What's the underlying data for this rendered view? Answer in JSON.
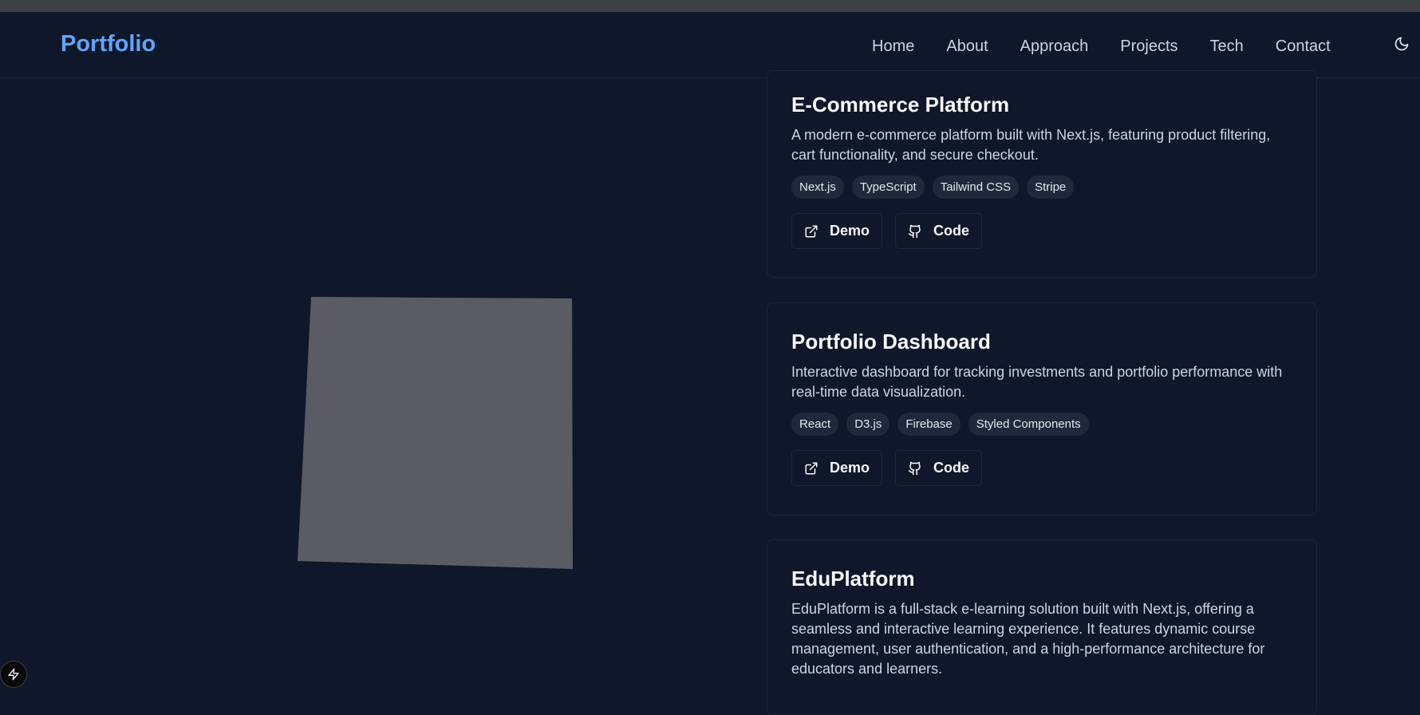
{
  "brand": "Portfolio",
  "nav": [
    "Home",
    "About",
    "Approach",
    "Projects",
    "Tech",
    "Contact"
  ],
  "icons": {
    "theme": "moon-icon",
    "demo": "external-link-icon",
    "code": "github-icon",
    "badge": "lightning-icon"
  },
  "colors": {
    "background": "#0f172a",
    "brand": "#60a5fa",
    "placeholder": "#5b5b63"
  },
  "projects": [
    {
      "title": "E-Commerce Platform",
      "description": "A modern e-commerce platform built with Next.js, featuring product filtering, cart functionality, and secure checkout.",
      "tags": [
        "Next.js",
        "TypeScript",
        "Tailwind CSS",
        "Stripe"
      ],
      "demo_label": "Demo",
      "code_label": "Code"
    },
    {
      "title": "Portfolio Dashboard",
      "description": "Interactive dashboard for tracking investments and portfolio performance with real-time data visualization.",
      "tags": [
        "React",
        "D3.js",
        "Firebase",
        "Styled Components"
      ],
      "demo_label": "Demo",
      "code_label": "Code"
    },
    {
      "title": "EduPlatform",
      "description": "EduPlatform is a full-stack e-learning solution built with Next.js, offering a seamless and interactive learning experience. It features dynamic course management, user authentication, and a high-performance architecture for educators and learners."
    }
  ]
}
